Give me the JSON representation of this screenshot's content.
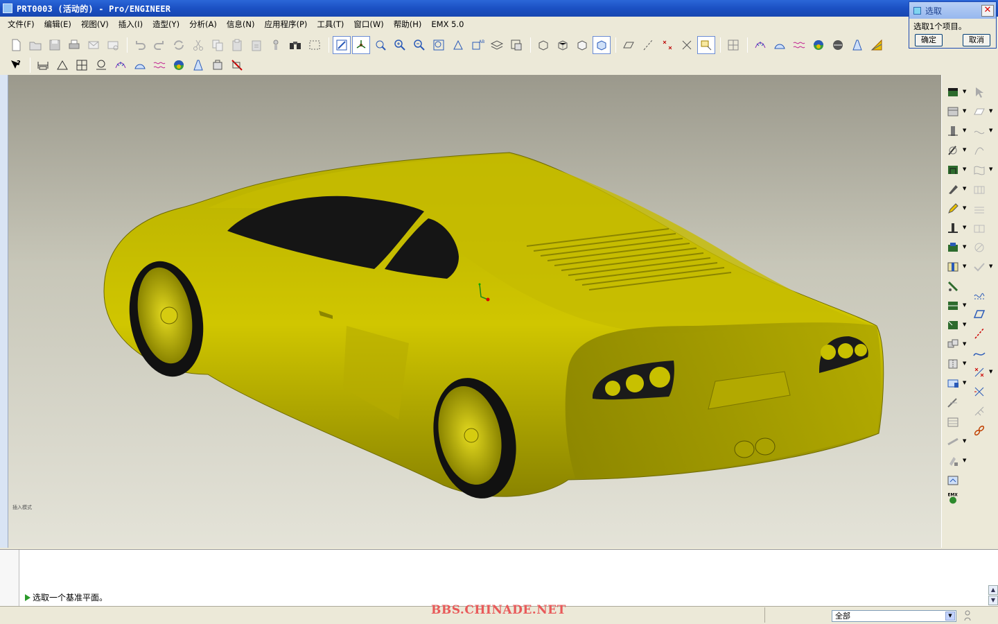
{
  "window": {
    "title": "PRT0003 (活动的) - Pro/ENGINEER"
  },
  "menus": [
    "文件(F)",
    "编辑(E)",
    "视图(V)",
    "插入(I)",
    "造型(Y)",
    "分析(A)",
    "信息(N)",
    "应用程序(P)",
    "工具(T)",
    "窗口(W)",
    "帮助(H)",
    "EMX 5.0"
  ],
  "select_dialog": {
    "title": "选取",
    "message": "选取1个项目。",
    "ok_label": "确定",
    "cancel_label": "取消"
  },
  "viewport": {
    "mode_label": "插入模式",
    "model_color": "#c8c000",
    "background_top": "#9b998c",
    "background_bottom": "#e4e3d8"
  },
  "message_area": {
    "prompt": "选取一个基准平面。"
  },
  "status": {
    "watermark": "BBS.CHINADE.NET",
    "filter_value": "全部"
  },
  "right_toolbar": {
    "emx_label": "EMX"
  }
}
